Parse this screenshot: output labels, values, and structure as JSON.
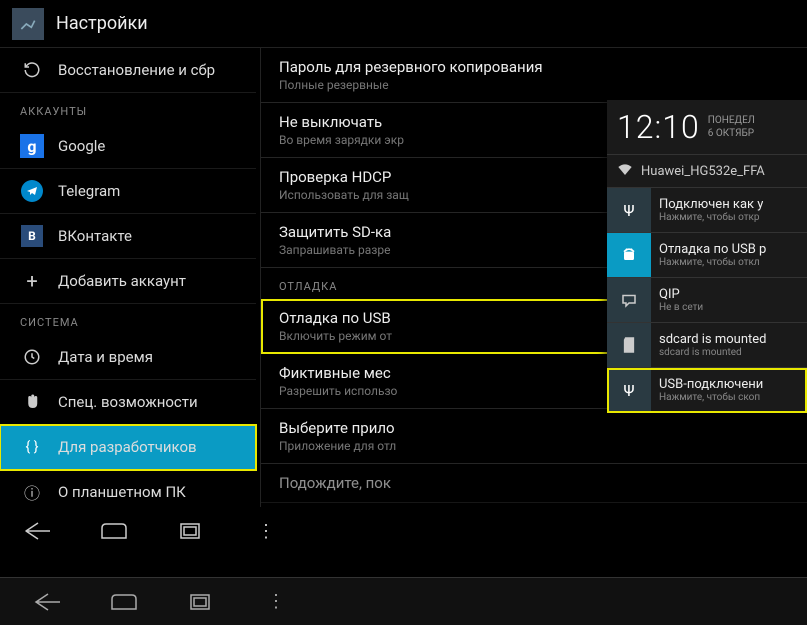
{
  "header": {
    "title": "Настройки"
  },
  "sidebar": {
    "backup": "Восстановление и сбр",
    "cat_accounts": "АККАУНТЫ",
    "google": "Google",
    "telegram": "Telegram",
    "vk": "ВКонтакте",
    "add_account": "Добавить аккаунт",
    "cat_system": "СИСТЕМА",
    "datetime": "Дата и время",
    "accessibility": "Спец. возможности",
    "developer": "Для разработчиков",
    "about": "О планшетном ПК"
  },
  "main": {
    "backup_pw": {
      "title": "Пароль для резервного копирования",
      "sub": "Полные резервные"
    },
    "stay_awake": {
      "title": "Не выключать",
      "sub": "Во время зарядки экр"
    },
    "hdcp": {
      "title": "Проверка HDCP",
      "sub": "Использовать для защ"
    },
    "protect_sd": {
      "title": "Защитить SD-ка",
      "sub": "Запрашивать разре"
    },
    "cat_debug": "ОТЛАДКА",
    "usb_debug": {
      "title": "Отладка по USB",
      "sub": "Включить режим от"
    },
    "mock_loc": {
      "title": "Фиктивные мес",
      "sub": "Разрешить использо"
    },
    "select_app": {
      "title": "Выберите прило",
      "sub": "Приложение для отл"
    },
    "wait_debug": {
      "title": "Подождите, пок",
      "sub": ""
    }
  },
  "notif": {
    "time": "12:10",
    "day": "ПОНЕДЕЛ",
    "date": "6 ОКТЯБР",
    "wifi": "Huawei_HG532e_FFA",
    "connected": {
      "title": "Подключен как у",
      "sub": "Нажмите, чтобы откр"
    },
    "usb_debug": {
      "title": "Отладка по USB р",
      "sub": "Нажмите, чтобы откл"
    },
    "qip": {
      "title": "QIP",
      "sub": "Не в сети"
    },
    "sdcard": {
      "title": "sdcard is mounted",
      "sub": "sdcard is mounted"
    },
    "usb_conn": {
      "title": "USB-подключени",
      "sub": "Нажмите, чтобы скоп"
    }
  },
  "icons": {
    "restore": "↻",
    "google": "g",
    "vk": "B",
    "plus": "+",
    "clock": "◔",
    "hand": "✋",
    "braces": "{ }",
    "info": "ⓘ",
    "wifi": "📶",
    "usb": "Ψ",
    "sd": "▤",
    "back": "◅",
    "home": "◯",
    "recent": "▭",
    "menu": "⋮"
  }
}
